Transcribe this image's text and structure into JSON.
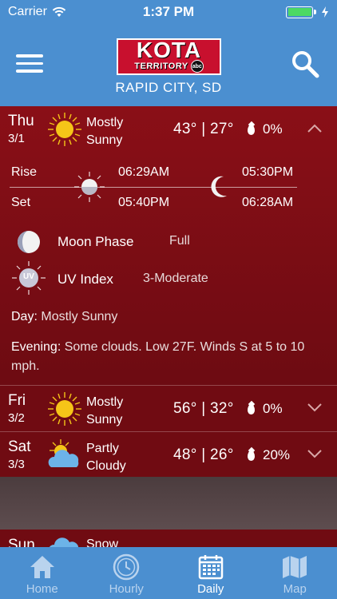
{
  "status": {
    "carrier": "Carrier",
    "time": "1:37 PM"
  },
  "header": {
    "logo_main": "KOTA",
    "logo_sub": "TERRITORY",
    "logo_badge": "abc",
    "location": "RAPID CITY, SD"
  },
  "days": [
    {
      "name": "Thu",
      "date": "3/1",
      "cond1": "Mostly",
      "cond2": "Sunny",
      "temps": "43° | 27°",
      "precip": "0%",
      "icon": "sun-icon",
      "expanded": true
    },
    {
      "name": "Fri",
      "date": "3/2",
      "cond1": "Mostly",
      "cond2": "Sunny",
      "temps": "56° | 32°",
      "precip": "0%",
      "icon": "sun-icon"
    },
    {
      "name": "Sat",
      "date": "3/3",
      "cond1": "Partly",
      "cond2": "Cloudy",
      "temps": "48° | 26°",
      "precip": "20%",
      "icon": "partly-cloudy-icon"
    },
    {
      "name": "Sun",
      "cond1": "Snow",
      "icon": "snow-cloud-icon"
    }
  ],
  "details": {
    "rise_label": "Rise",
    "set_label": "Set",
    "sunrise": "06:29AM",
    "sunset": "05:40PM",
    "moonrise": "05:30PM",
    "moonset": "06:28AM",
    "moon_phase_label": "Moon Phase",
    "moon_phase_value": "Full",
    "uv_label": "UV Index",
    "uv_value": "3-Moderate",
    "uv_badge": "UV",
    "day_label": "Day:",
    "day_text": "Mostly Sunny",
    "evening_label": "Evening:",
    "evening_text": "Some clouds. Low 27F. Winds S at 5 to 10 mph."
  },
  "tabs": [
    {
      "label": "Home",
      "icon": "home-icon",
      "active": false
    },
    {
      "label": "Hourly",
      "icon": "clock-icon",
      "active": false
    },
    {
      "label": "Daily",
      "icon": "calendar-icon",
      "active": true
    },
    {
      "label": "Map",
      "icon": "map-icon",
      "active": false
    }
  ],
  "colors": {
    "header_blue": "#4b8fd0",
    "day_red": "#700b12",
    "sun_yellow": "#f5c518",
    "battery_green": "#4cd964"
  }
}
